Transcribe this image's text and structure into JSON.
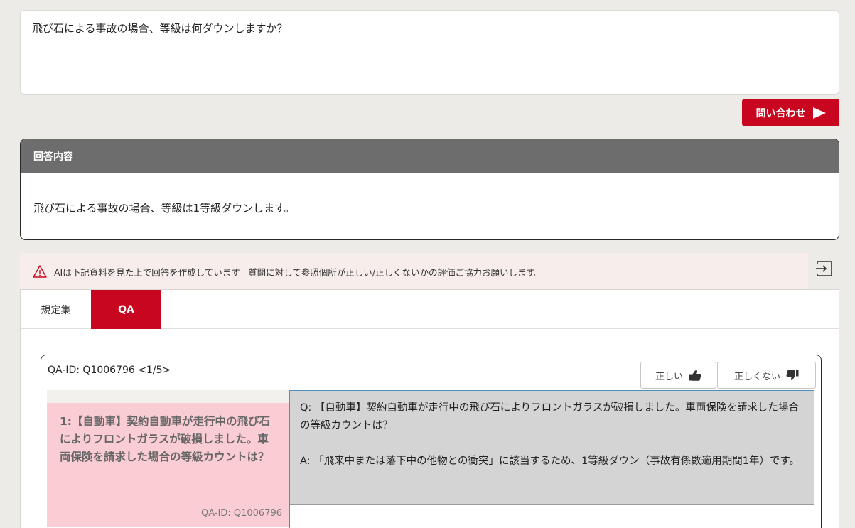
{
  "question": {
    "text": "飛び石による事故の場合、等級は何ダウンしますか？"
  },
  "submit": {
    "label": "問い合わせ"
  },
  "answer": {
    "header": "回答内容",
    "body": "飛び石による事故の場合、等級は1等級ダウンします。"
  },
  "notice": {
    "text": "AIは下記資料を見た上で回答を作成しています。質問に対して参照個所が正しい/正しくないかの評価ご協力お願いします。"
  },
  "tabs": [
    {
      "label": "規定集",
      "active": false
    },
    {
      "label": "QA",
      "active": true
    }
  ],
  "qa": {
    "header": "QA-ID: Q1006796 <1/5>",
    "feedback": {
      "correct_label": "正しい",
      "incorrect_label": "正しくない"
    },
    "list_item": {
      "title": "1:【自動車】契約自動車が走行中の飛び石によりフロントガラスが破損しました。車両保険を請求した場合の等級カウントは？",
      "id": "QA-ID: Q1006796"
    },
    "detail": {
      "question": "Q: 【自動車】契約自動車が走行中の飛び石によりフロントガラスが破損しました。車両保険を請求した場合の等級カウントは？",
      "answer": "A: 「飛来中または落下中の他物との衝突」に該当するため、1等級ダウン（事故有係数適用期間1年）です。"
    }
  },
  "colors": {
    "accent": "#c9061f",
    "header_bg": "#6d6d6d",
    "selected_item_bg": "#f9cdd3"
  }
}
